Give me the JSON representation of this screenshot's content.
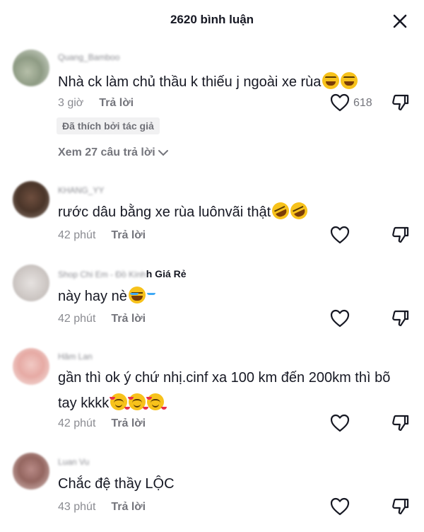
{
  "header": {
    "title": "2620 bình luận",
    "close_icon": "close-icon"
  },
  "comments": [
    {
      "username": "Quang_Bamboo",
      "username_suffix": "",
      "text": "Nhà ck làm chủ thầu k thiếu j ngoài xe rùa",
      "emojis": [
        "grinning-squinting-face",
        "grinning-squinting-face"
      ],
      "time": "3 giờ",
      "reply_label": "Trả lời",
      "like_count": "618",
      "badge": "Đã thích bởi tác giả",
      "view_replies": "Xem 27 câu trả lời"
    },
    {
      "username": "KHANG_YY",
      "username_suffix": "",
      "text": "rước dâu bằng xe rùa luônvãi thật",
      "emojis": [
        "rolling-on-floor-laughing",
        "rolling-on-floor-laughing"
      ],
      "time": "42 phút",
      "reply_label": "Trả lời"
    },
    {
      "username": "Shop Chi Em - Đồ Kính",
      "username_suffix": "h Giá Rẻ",
      "text": "này hay nè",
      "emojis": [
        "face-with-tears-of-joy"
      ],
      "time": "42 phút",
      "reply_label": "Trả lời"
    },
    {
      "username": "Hâm Lan",
      "username_suffix": "",
      "text": "gần thì ok ý chứ nhị.cinf xa 100 km đến 200km thì bõ tay kkkk",
      "emojis": [
        "smiling-face-with-hearts",
        "smiling-face-with-hearts",
        "smiling-face-with-hearts"
      ],
      "time": "42 phút",
      "reply_label": "Trả lời"
    },
    {
      "username": "Luan Vu",
      "username_suffix": "",
      "text": "Chắc đệ thầy LỘC",
      "emojis": [],
      "time": "43 phút",
      "reply_label": "Trả lời"
    }
  ],
  "icons": {
    "like": "heart-outline-icon",
    "dislike": "thumbs-down-icon",
    "chevron": "chevron-down-icon"
  },
  "colors": {
    "text": "#161823",
    "muted": "#8a8b91",
    "badge_bg": "#f1f1f2"
  }
}
